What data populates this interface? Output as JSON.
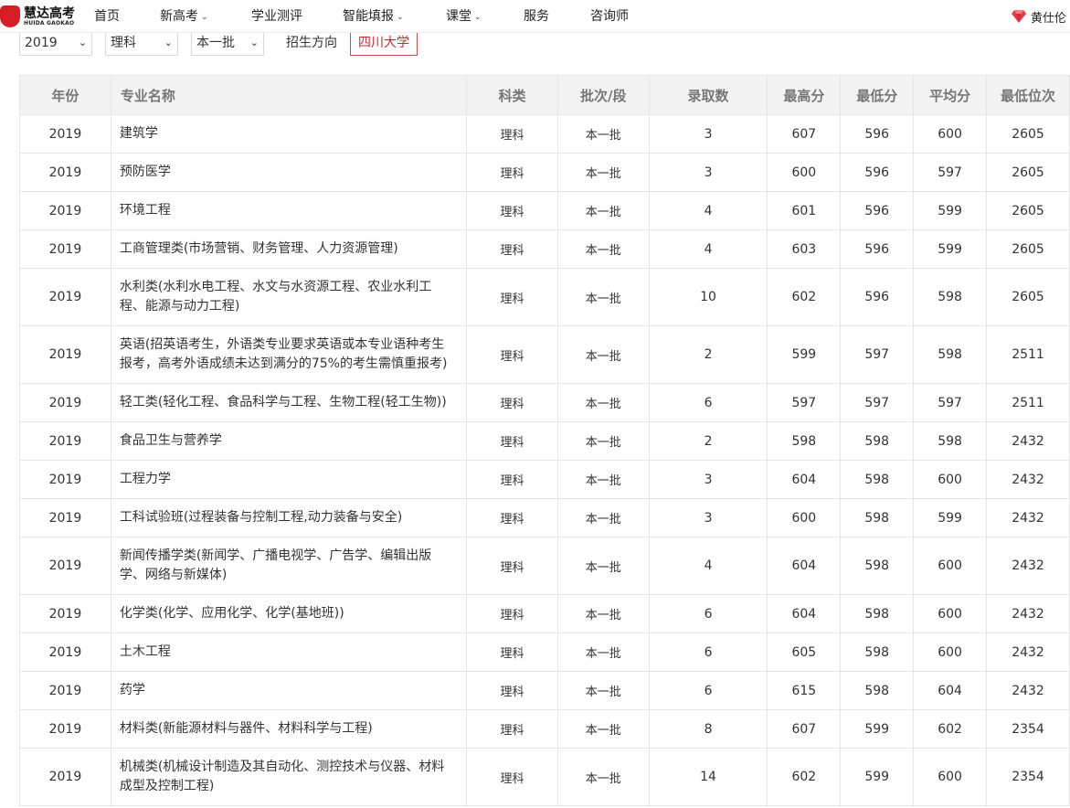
{
  "brand": {
    "name_cn": "慧达高考",
    "name_en": "HUIDA GAOKAO",
    "mark": "HD"
  },
  "nav": [
    {
      "label": "首页",
      "dropdown": false
    },
    {
      "label": "新高考",
      "dropdown": true
    },
    {
      "label": "学业测评",
      "dropdown": false
    },
    {
      "label": "智能填报",
      "dropdown": true
    },
    {
      "label": "课堂",
      "dropdown": true
    },
    {
      "label": "服务",
      "dropdown": false
    },
    {
      "label": "咨询师",
      "dropdown": false
    }
  ],
  "user": {
    "name": "黄仕伦",
    "icon": "diamond-icon"
  },
  "filters": {
    "year": "2019",
    "subject": "理科",
    "batch": "本一批",
    "direction_label": "招生方向",
    "school": "四川大学"
  },
  "table": {
    "headers": [
      "年份",
      "专业名称",
      "科类",
      "批次/段",
      "录取数",
      "最高分",
      "最低分",
      "平均分",
      "最低位次"
    ],
    "rows": [
      {
        "year": "2019",
        "major": "建筑学",
        "type": "理科",
        "batch": "本一批",
        "count": "3",
        "max": "607",
        "min": "596",
        "avg": "600",
        "rank": "2605"
      },
      {
        "year": "2019",
        "major": "预防医学",
        "type": "理科",
        "batch": "本一批",
        "count": "3",
        "max": "600",
        "min": "596",
        "avg": "597",
        "rank": "2605"
      },
      {
        "year": "2019",
        "major": "环境工程",
        "type": "理科",
        "batch": "本一批",
        "count": "4",
        "max": "601",
        "min": "596",
        "avg": "599",
        "rank": "2605"
      },
      {
        "year": "2019",
        "major": "工商管理类(市场营销、财务管理、人力资源管理)",
        "type": "理科",
        "batch": "本一批",
        "count": "4",
        "max": "603",
        "min": "596",
        "avg": "599",
        "rank": "2605"
      },
      {
        "year": "2019",
        "major": "水利类(水利水电工程、水文与水资源工程、农业水利工程、能源与动力工程)",
        "type": "理科",
        "batch": "本一批",
        "count": "10",
        "max": "602",
        "min": "596",
        "avg": "598",
        "rank": "2605",
        "tall": true
      },
      {
        "year": "2019",
        "major": "英语(招英语考生，外语类专业要求英语或本专业语种考生报考，高考外语成绩未达到满分的75%的考生需慎重报考)",
        "type": "理科",
        "batch": "本一批",
        "count": "2",
        "max": "599",
        "min": "597",
        "avg": "598",
        "rank": "2511",
        "tall": true
      },
      {
        "year": "2019",
        "major": "轻工类(轻化工程、食品科学与工程、生物工程(轻工生物))",
        "type": "理科",
        "batch": "本一批",
        "count": "6",
        "max": "597",
        "min": "597",
        "avg": "597",
        "rank": "2511"
      },
      {
        "year": "2019",
        "major": "食品卫生与营养学",
        "type": "理科",
        "batch": "本一批",
        "count": "2",
        "max": "598",
        "min": "598",
        "avg": "598",
        "rank": "2432"
      },
      {
        "year": "2019",
        "major": "工程力学",
        "type": "理科",
        "batch": "本一批",
        "count": "3",
        "max": "604",
        "min": "598",
        "avg": "600",
        "rank": "2432"
      },
      {
        "year": "2019",
        "major": "工科试验班(过程装备与控制工程,动力装备与安全)",
        "type": "理科",
        "batch": "本一批",
        "count": "3",
        "max": "600",
        "min": "598",
        "avg": "599",
        "rank": "2432"
      },
      {
        "year": "2019",
        "major": "新闻传播学类(新闻学、广播电视学、广告学、编辑出版学、网络与新媒体)",
        "type": "理科",
        "batch": "本一批",
        "count": "4",
        "max": "604",
        "min": "598",
        "avg": "600",
        "rank": "2432",
        "tall": true
      },
      {
        "year": "2019",
        "major": "化学类(化学、应用化学、化学(基地班))",
        "type": "理科",
        "batch": "本一批",
        "count": "6",
        "max": "604",
        "min": "598",
        "avg": "600",
        "rank": "2432"
      },
      {
        "year": "2019",
        "major": "土木工程",
        "type": "理科",
        "batch": "本一批",
        "count": "6",
        "max": "605",
        "min": "598",
        "avg": "600",
        "rank": "2432"
      },
      {
        "year": "2019",
        "major": "药学",
        "type": "理科",
        "batch": "本一批",
        "count": "6",
        "max": "615",
        "min": "598",
        "avg": "604",
        "rank": "2432"
      },
      {
        "year": "2019",
        "major": "材料类(新能源材料与器件、材料科学与工程)",
        "type": "理科",
        "batch": "本一批",
        "count": "8",
        "max": "607",
        "min": "599",
        "avg": "602",
        "rank": "2354"
      },
      {
        "year": "2019",
        "major": "机械类(机械设计制造及其自动化、测控技术与仪器、材料成型及控制工程)",
        "type": "理科",
        "batch": "本一批",
        "count": "14",
        "max": "602",
        "min": "599",
        "avg": "600",
        "rank": "2354",
        "tall": true
      }
    ]
  }
}
